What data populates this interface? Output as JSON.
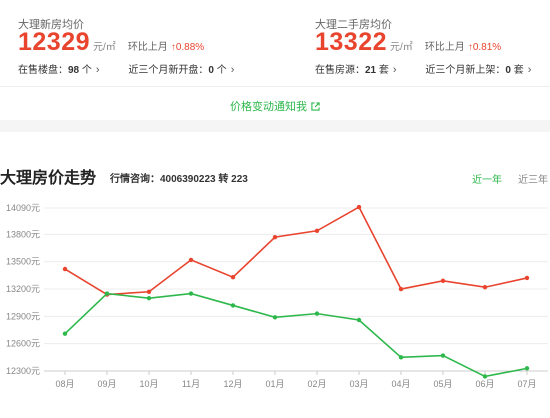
{
  "new_house": {
    "title": "大理新房均价",
    "price": "12329",
    "unit": "元/㎡",
    "mom_label": "环比上月",
    "mom_value": "↑0.88%",
    "stat1_label": "在售楼盘：",
    "stat1_value": "98",
    "stat1_unit": "个",
    "stat2_label": "近三个月新开盘：",
    "stat2_value": "0",
    "stat2_unit": "个"
  },
  "second_hand": {
    "title": "大理二手房均价",
    "price": "13322",
    "unit": "元/㎡",
    "mom_label": "环比上月",
    "mom_value": "↑0.81%",
    "stat1_label": "在售房源：",
    "stat1_value": "21",
    "stat1_unit": "套",
    "stat2_label": "近三个月新上架：",
    "stat2_value": "0",
    "stat2_unit": "套"
  },
  "notify": {
    "label": "价格变动通知我"
  },
  "trend": {
    "title": "大理房价走势",
    "hotline": "行情咨询：4006390223 转 223",
    "tabs": [
      "近一年",
      "近三年"
    ]
  },
  "icons": {
    "chevron": "chevron-right-icon",
    "notify": "external-link-icon"
  },
  "colors": {
    "accent_red": "#e8442e",
    "accent_green": "#2eb84c"
  },
  "chart_data": {
    "type": "line",
    "categories": [
      "08月",
      "09月",
      "10月",
      "11月",
      "12月",
      "01月",
      "02月",
      "03月",
      "04月",
      "05月",
      "06月",
      "07月"
    ],
    "series": [
      {
        "color": "#e8442e",
        "values": [
          13420,
          13140,
          13170,
          13520,
          13330,
          13770,
          13840,
          14100,
          13200,
          13290,
          13220,
          13322
        ]
      },
      {
        "color": "#2eb84c",
        "values": [
          12710,
          13150,
          13100,
          13150,
          13020,
          12890,
          12930,
          12860,
          12450,
          12470,
          12240,
          12329
        ]
      }
    ],
    "yticks": [
      "12300元",
      "12600元",
      "12900元",
      "13200元",
      "13500元",
      "13800元",
      "14090元"
    ],
    "ylim": [
      12300,
      14090
    ],
    "grid": true
  }
}
